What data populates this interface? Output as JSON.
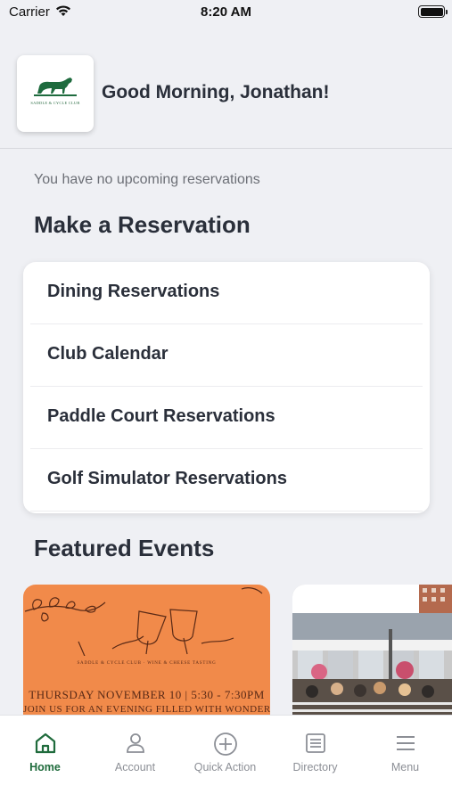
{
  "status_bar": {
    "carrier": "Carrier",
    "time": "8:20 AM"
  },
  "header": {
    "logo_alt": "SADDLE & CYCLE CLUB",
    "greeting": "Good Morning, Jonathan!"
  },
  "reservations": {
    "empty_message": "You have no upcoming reservations",
    "section_title": "Make a Reservation",
    "items": [
      {
        "label": "Dining Reservations"
      },
      {
        "label": "Club Calendar"
      },
      {
        "label": "Paddle Court Reservations"
      },
      {
        "label": "Golf Simulator Reservations"
      }
    ]
  },
  "featured": {
    "section_title": "Featured Events",
    "events": [
      {
        "small_text": "SADDLE & CYCLE CLUB · WINE & CHEESE TASTING",
        "date_line": "THURSDAY NOVEMBER 10 | 5:30 - 7:30PM",
        "tagline": "JOIN US FOR AN EVENING FILLED WITH WONDERFUL",
        "color": "#f18a4a"
      },
      {
        "color": "#c9c9c9"
      }
    ]
  },
  "tab_bar": {
    "active_color": "#1f6b3c",
    "tabs": [
      {
        "label": "Home",
        "icon": "home-icon",
        "active": true
      },
      {
        "label": "Account",
        "icon": "account-icon"
      },
      {
        "label": "Quick Action",
        "icon": "plus-circle-icon"
      },
      {
        "label": "Directory",
        "icon": "directory-icon"
      },
      {
        "label": "Menu",
        "icon": "menu-icon"
      }
    ]
  }
}
